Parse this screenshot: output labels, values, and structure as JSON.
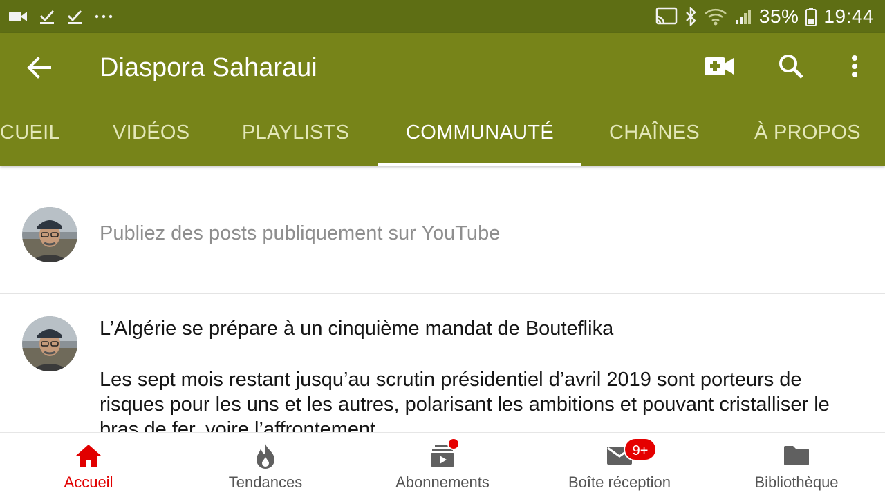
{
  "status_bar": {
    "left_icons": [
      "video-camera-icon",
      "check-download-icon",
      "check-download-icon",
      "more-dots-icon"
    ],
    "battery_percent": "35%",
    "time": "19:44"
  },
  "app_bar": {
    "title": "Diaspora Saharaui"
  },
  "tabs": [
    {
      "label": "CUEIL",
      "active": false
    },
    {
      "label": "VIDÉOS",
      "active": false
    },
    {
      "label": "PLAYLISTS",
      "active": false
    },
    {
      "label": "COMMUNAUTÉ",
      "active": true
    },
    {
      "label": "CHAÎNES",
      "active": false
    },
    {
      "label": "À PROPOS",
      "active": false
    }
  ],
  "compose": {
    "placeholder": "Publiez des posts publiquement sur YouTube"
  },
  "post": {
    "title": "L’Algérie se prépare à un cinquième mandat de Bouteflika",
    "body": "Les sept mois restant jusqu’au scrutin présidentiel d’avril 2019 sont porteurs de risques pour les uns et les autres, polarisant les ambitions et pouvant cristalliser le bras de fer, voire l’affrontement."
  },
  "bottom_nav": [
    {
      "label": "Accueil",
      "icon": "home-icon",
      "active": true
    },
    {
      "label": "Tendances",
      "icon": "flame-icon",
      "active": false
    },
    {
      "label": "Abonnements",
      "icon": "subscriptions-icon",
      "active": false
    },
    {
      "label": "Boîte réception",
      "icon": "inbox-icon",
      "active": false,
      "badge": "9+"
    },
    {
      "label": "Bibliothèque",
      "icon": "folder-icon",
      "active": false
    }
  ],
  "colors": {
    "status_bar": "#5e6e14",
    "app_bar": "#778419",
    "accent_red": "#e10000"
  }
}
